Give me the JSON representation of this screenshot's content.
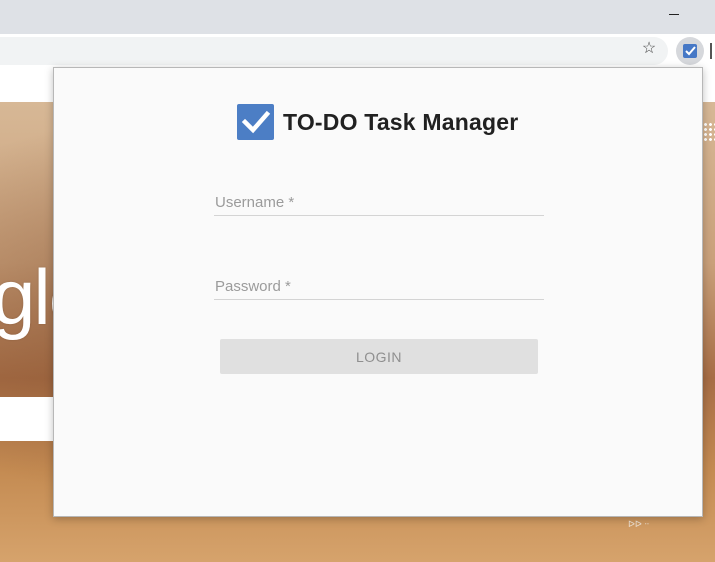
{
  "browser": {
    "star_glyph": "☆",
    "extension_icon": "todo-checkbox-icon"
  },
  "background": {
    "partial_logo_text": "gle",
    "corner_text": "ᐅᐅ ᐧᐧ"
  },
  "app": {
    "title": "TO-DO Task Manager",
    "accent_color": "#4c7ec5",
    "username": {
      "label": "Username *",
      "value": ""
    },
    "password": {
      "label": "Password *",
      "value": ""
    },
    "login_label": "LOGIN"
  }
}
